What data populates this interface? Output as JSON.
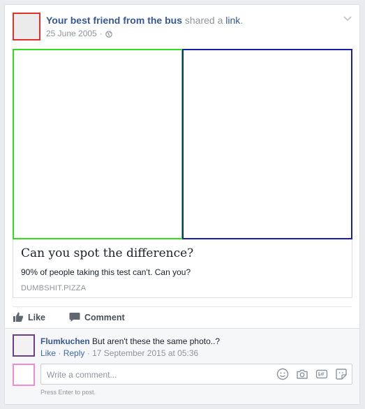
{
  "post": {
    "author": "Your best friend from the bus",
    "action_text": "shared a",
    "action_link": "link",
    "action_end": ".",
    "date": "25 June 2005",
    "separator": "·",
    "privacy_icon": "globe-icon",
    "menu_icon": "chevron-down-icon"
  },
  "link_preview": {
    "title": "Can you spot the difference?",
    "description": "90% of people taking this test can't. Can you?",
    "domain": "DUMBSHIT.PIZZA"
  },
  "actions": {
    "like_label": "Like",
    "comment_label": "Comment"
  },
  "comment": {
    "author": "Flumkuchen",
    "text": "But aren't these the same photo..?",
    "like_label": "Like",
    "sep1": "·",
    "reply_label": "Reply",
    "sep2": "·",
    "timestamp": "17 September 2015 at 05:36"
  },
  "composer": {
    "placeholder": "Write a comment...",
    "hint": "Press Enter to post.",
    "tools": [
      "emoji-icon",
      "camera-icon",
      "gif-icon",
      "sticker-icon"
    ]
  },
  "colors": {
    "main_avatar_border": "#e0312d",
    "left_image_border": "#33dd22",
    "right_image_border": "#1a1fa8",
    "comment_avatar_border": "#6b3f86",
    "composer_avatar_border": "#f28ad8",
    "link_blue": "#365899"
  }
}
